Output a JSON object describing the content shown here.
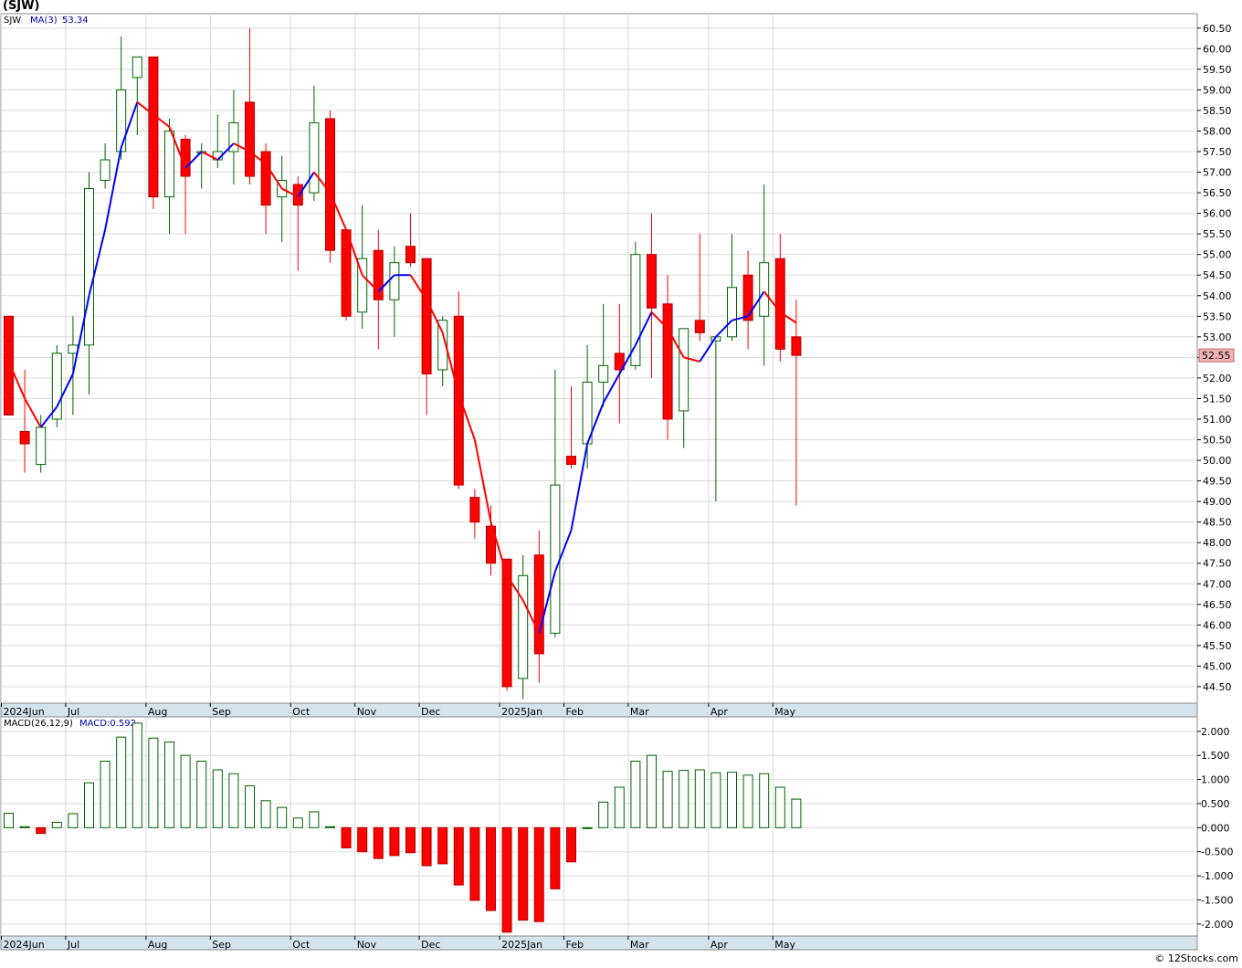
{
  "symbol": "(SJW)",
  "credit": "© 12Stocks.com",
  "colors": {
    "up": "#006400",
    "down": "#ff0000",
    "ma_up": "#0000ff",
    "ma_down": "#ff0000",
    "grid": "#dcdcdc",
    "axis_band": "#d4e3ec",
    "price_box": "#f4b4b4"
  },
  "chart_data": [
    {
      "type": "candlestick",
      "legend": {
        "ticker": "SJW",
        "ma_label": "MA(3)",
        "ma_value": "53.34"
      },
      "last_price_label": "52.55",
      "ylim": [
        44.1,
        60.85
      ],
      "yticks": [
        "44.50",
        "45.00",
        "45.50",
        "46.00",
        "46.50",
        "47.00",
        "47.50",
        "48.00",
        "48.50",
        "49.00",
        "49.50",
        "50.00",
        "50.50",
        "51.00",
        "51.50",
        "52.00",
        "52.50",
        "53.00",
        "53.50",
        "54.00",
        "54.50",
        "55.00",
        "55.50",
        "56.00",
        "56.50",
        "57.00",
        "57.50",
        "58.00",
        "58.50",
        "59.00",
        "59.50",
        "60.00",
        "60.50"
      ],
      "xticks": [
        {
          "label": "2024Jun",
          "index": 0
        },
        {
          "label": "Jul",
          "index": 4
        },
        {
          "label": "Aug",
          "index": 9
        },
        {
          "label": "Sep",
          "index": 13
        },
        {
          "label": "Oct",
          "index": 18
        },
        {
          "label": "Nov",
          "index": 22
        },
        {
          "label": "Dec",
          "index": 26
        },
        {
          "label": "2025Jan",
          "index": 31
        },
        {
          "label": "Feb",
          "index": 35
        },
        {
          "label": "Mar",
          "index": 39
        },
        {
          "label": "Apr",
          "index": 44
        },
        {
          "label": "May",
          "index": 48
        }
      ],
      "candles": [
        {
          "o": 53.5,
          "h": 53.5,
          "l": 51.1,
          "c": 51.1
        },
        {
          "o": 50.7,
          "h": 52.2,
          "l": 49.7,
          "c": 50.4
        },
        {
          "o": 49.9,
          "h": 51.1,
          "l": 49.7,
          "c": 50.8
        },
        {
          "o": 51.0,
          "h": 52.8,
          "l": 50.8,
          "c": 52.6
        },
        {
          "o": 52.6,
          "h": 53.5,
          "l": 51.1,
          "c": 52.8
        },
        {
          "o": 52.8,
          "h": 57.0,
          "l": 51.6,
          "c": 56.6
        },
        {
          "o": 56.8,
          "h": 57.7,
          "l": 56.6,
          "c": 57.3
        },
        {
          "o": 57.5,
          "h": 60.3,
          "l": 57.3,
          "c": 59.0
        },
        {
          "o": 59.3,
          "h": 59.8,
          "l": 57.9,
          "c": 59.8
        },
        {
          "o": 59.8,
          "h": 59.8,
          "l": 56.1,
          "c": 56.4
        },
        {
          "o": 56.4,
          "h": 58.3,
          "l": 55.5,
          "c": 58.0
        },
        {
          "o": 57.8,
          "h": 57.9,
          "l": 55.5,
          "c": 56.9
        },
        {
          "o": 57.5,
          "h": 57.7,
          "l": 56.6,
          "c": 57.5
        },
        {
          "o": 57.3,
          "h": 58.4,
          "l": 57.1,
          "c": 57.5
        },
        {
          "o": 57.5,
          "h": 59.0,
          "l": 56.7,
          "c": 58.2
        },
        {
          "o": 58.7,
          "h": 60.5,
          "l": 56.7,
          "c": 56.9
        },
        {
          "o": 57.5,
          "h": 57.7,
          "l": 55.5,
          "c": 56.2
        },
        {
          "o": 56.4,
          "h": 57.4,
          "l": 55.3,
          "c": 56.8
        },
        {
          "o": 56.7,
          "h": 56.9,
          "l": 54.6,
          "c": 56.2
        },
        {
          "o": 56.5,
          "h": 59.1,
          "l": 56.3,
          "c": 58.2
        },
        {
          "o": 58.3,
          "h": 58.5,
          "l": 54.8,
          "c": 55.1
        },
        {
          "o": 55.6,
          "h": 55.6,
          "l": 53.4,
          "c": 53.5
        },
        {
          "o": 53.6,
          "h": 56.2,
          "l": 53.2,
          "c": 54.9
        },
        {
          "o": 55.1,
          "h": 55.6,
          "l": 52.7,
          "c": 53.9
        },
        {
          "o": 53.9,
          "h": 55.2,
          "l": 53.0,
          "c": 54.8
        },
        {
          "o": 55.2,
          "h": 56.0,
          "l": 54.7,
          "c": 54.8
        },
        {
          "o": 54.9,
          "h": 54.9,
          "l": 51.1,
          "c": 52.1
        },
        {
          "o": 52.2,
          "h": 53.5,
          "l": 51.8,
          "c": 53.4
        },
        {
          "o": 53.5,
          "h": 54.1,
          "l": 49.3,
          "c": 49.4
        },
        {
          "o": 49.1,
          "h": 49.3,
          "l": 48.1,
          "c": 48.5
        },
        {
          "o": 48.4,
          "h": 48.9,
          "l": 47.2,
          "c": 47.5
        },
        {
          "o": 47.6,
          "h": 47.6,
          "l": 44.4,
          "c": 44.5
        },
        {
          "o": 44.7,
          "h": 47.7,
          "l": 44.2,
          "c": 47.2
        },
        {
          "o": 47.7,
          "h": 48.3,
          "l": 44.6,
          "c": 45.3
        },
        {
          "o": 45.8,
          "h": 52.2,
          "l": 45.7,
          "c": 49.4
        },
        {
          "o": 50.1,
          "h": 51.8,
          "l": 49.8,
          "c": 49.9
        },
        {
          "o": 50.4,
          "h": 52.8,
          "l": 49.8,
          "c": 51.9
        },
        {
          "o": 51.9,
          "h": 53.8,
          "l": 51.3,
          "c": 52.3
        },
        {
          "o": 52.6,
          "h": 53.8,
          "l": 50.9,
          "c": 52.2
        },
        {
          "o": 52.3,
          "h": 55.3,
          "l": 52.2,
          "c": 55.0
        },
        {
          "o": 55.0,
          "h": 56.0,
          "l": 52.0,
          "c": 53.7
        },
        {
          "o": 53.8,
          "h": 54.5,
          "l": 50.5,
          "c": 51.0
        },
        {
          "o": 51.2,
          "h": 53.2,
          "l": 50.3,
          "c": 53.2
        },
        {
          "o": 53.4,
          "h": 55.5,
          "l": 52.9,
          "c": 53.1
        },
        {
          "o": 52.9,
          "h": 53.0,
          "l": 49.0,
          "c": 53.0
        },
        {
          "o": 53.0,
          "h": 55.5,
          "l": 52.9,
          "c": 54.2
        },
        {
          "o": 54.5,
          "h": 55.1,
          "l": 52.7,
          "c": 53.4
        },
        {
          "o": 53.5,
          "h": 56.7,
          "l": 52.3,
          "c": 54.8
        },
        {
          "o": 54.9,
          "h": 55.5,
          "l": 52.4,
          "c": 52.7
        },
        {
          "o": 53.0,
          "h": 53.9,
          "l": 48.9,
          "c": 52.55
        }
      ],
      "ma3": [
        52.4,
        51.5,
        50.8,
        51.3,
        52.1,
        54.0,
        55.6,
        57.6,
        58.7,
        58.4,
        58.1,
        57.1,
        57.5,
        57.3,
        57.7,
        57.5,
        57.2,
        56.6,
        56.4,
        57.0,
        56.5,
        55.6,
        54.5,
        54.1,
        54.5,
        54.5,
        53.9,
        53.1,
        51.6,
        50.5,
        48.5,
        47.2,
        46.6,
        45.8,
        47.3,
        48.3,
        50.4,
        51.4,
        52.1,
        52.8,
        53.6,
        53.2,
        52.5,
        52.4,
        53.0,
        53.4,
        53.5,
        54.1,
        53.6,
        53.34
      ]
    },
    {
      "type": "bar",
      "legend": {
        "indicator": "MACD(26,12,9)",
        "value_label": "MACD:0.592"
      },
      "ylim": [
        -2.25,
        2.3
      ],
      "yticks": [
        "2.000",
        "1.500",
        "1.000",
        "0.500",
        "0.000",
        "-0.500",
        "-1.000",
        "-1.500",
        "-2.000"
      ],
      "values": [
        0.3,
        0.02,
        -0.12,
        0.11,
        0.29,
        0.93,
        1.38,
        1.88,
        2.17,
        1.86,
        1.78,
        1.5,
        1.38,
        1.2,
        1.12,
        0.87,
        0.56,
        0.42,
        0.2,
        0.33,
        0.02,
        -0.42,
        -0.5,
        -0.64,
        -0.58,
        -0.52,
        -0.79,
        -0.75,
        -1.19,
        -1.51,
        -1.72,
        -2.17,
        -1.92,
        -1.95,
        -1.27,
        -0.71,
        0.0,
        0.53,
        0.84,
        1.38,
        1.5,
        1.17,
        1.19,
        1.2,
        1.14,
        1.15,
        1.09,
        1.12,
        0.84,
        0.592
      ]
    }
  ]
}
